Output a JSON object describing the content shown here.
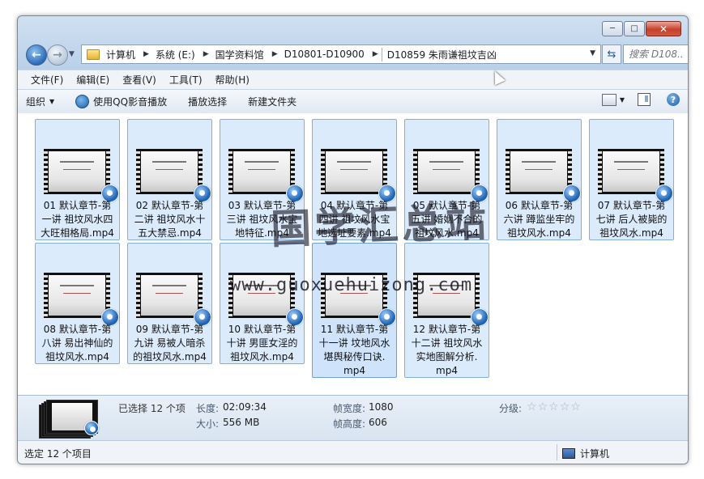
{
  "window": {
    "caption": {
      "minimize": "─",
      "maximize": "□",
      "close": "✕"
    }
  },
  "address": {
    "crumbs": [
      "计算机",
      "系统 (E:)",
      "国学资料馆",
      "D10801-D10900",
      "D10859 朱雨谦祖坟吉凶"
    ],
    "search_placeholder": "搜索 D108..."
  },
  "menu": [
    "文件(F)",
    "编辑(E)",
    "查看(V)",
    "工具(T)",
    "帮助(H)"
  ],
  "commands": {
    "organize": "组织",
    "play_qq": "使用QQ影音播放",
    "play_selection": "播放选择",
    "new_folder": "新建文件夹"
  },
  "files": [
    {
      "line1": "01 默认章节-第",
      "line2": "一讲 祖坟风水四",
      "line3": "大旺相格局.mp4"
    },
    {
      "line1": "02 默认章节-第",
      "line2": "二讲 祖坟风水十",
      "line3": "五大禁忌.mp4"
    },
    {
      "line1": "03 默认章节-第",
      "line2": "三讲 祖坟风水宝",
      "line3": "地特征.mp4"
    },
    {
      "line1": "04 默认章节-第",
      "line2": "四讲 祖坟风水宝",
      "line3": "地选址要素.mp4"
    },
    {
      "line1": "05 默认章节-第",
      "line2": "五讲 婚姻不合的",
      "line3": "祖坟风水.mp4"
    },
    {
      "line1": "06 默认章节-第",
      "line2": "六讲 蹲监坐牢的",
      "line3": "祖坟风水.mp4"
    },
    {
      "line1": "07 默认章节-第",
      "line2": "七讲 后人被毙的",
      "line3": "祖坟风水.mp4"
    },
    {
      "line1": "08 默认章节-第",
      "line2": "八讲 易出神仙的",
      "line3": "祖坟风水.mp4"
    },
    {
      "line1": "09 默认章节-第",
      "line2": "九讲 易被人暗杀",
      "line3": "的祖坟风水.mp4"
    },
    {
      "line1": "10 默认章节-第",
      "line2": "十讲 男匪女淫的",
      "line3": "祖坟风水.mp4"
    },
    {
      "line1": "11 默认章节-第",
      "line2": "十一讲 坟地风水",
      "line3": "堪舆秘传口诀.",
      "line4": "mp4"
    },
    {
      "line1": "12 默认章节-第",
      "line2": "十二讲 祖坟风水",
      "line3": "实地图解分析.",
      "line4": "mp4"
    }
  ],
  "watermark": {
    "cn": "国学汇总站",
    "url": "www.guoxuehuizong.com"
  },
  "details": {
    "selected": "已选择 12 个项",
    "length_label": "长度:",
    "length_value": "02:09:34",
    "size_label": "大小:",
    "size_value": "556 MB",
    "frame_width_label": "帧宽度:",
    "frame_width_value": "1080",
    "frame_height_label": "帧高度:",
    "frame_height_value": "606",
    "rating_label": "分级:",
    "rating_stars": 0,
    "rating_max": 5
  },
  "status": {
    "left": "选定 12 个项目",
    "right": "计算机"
  }
}
